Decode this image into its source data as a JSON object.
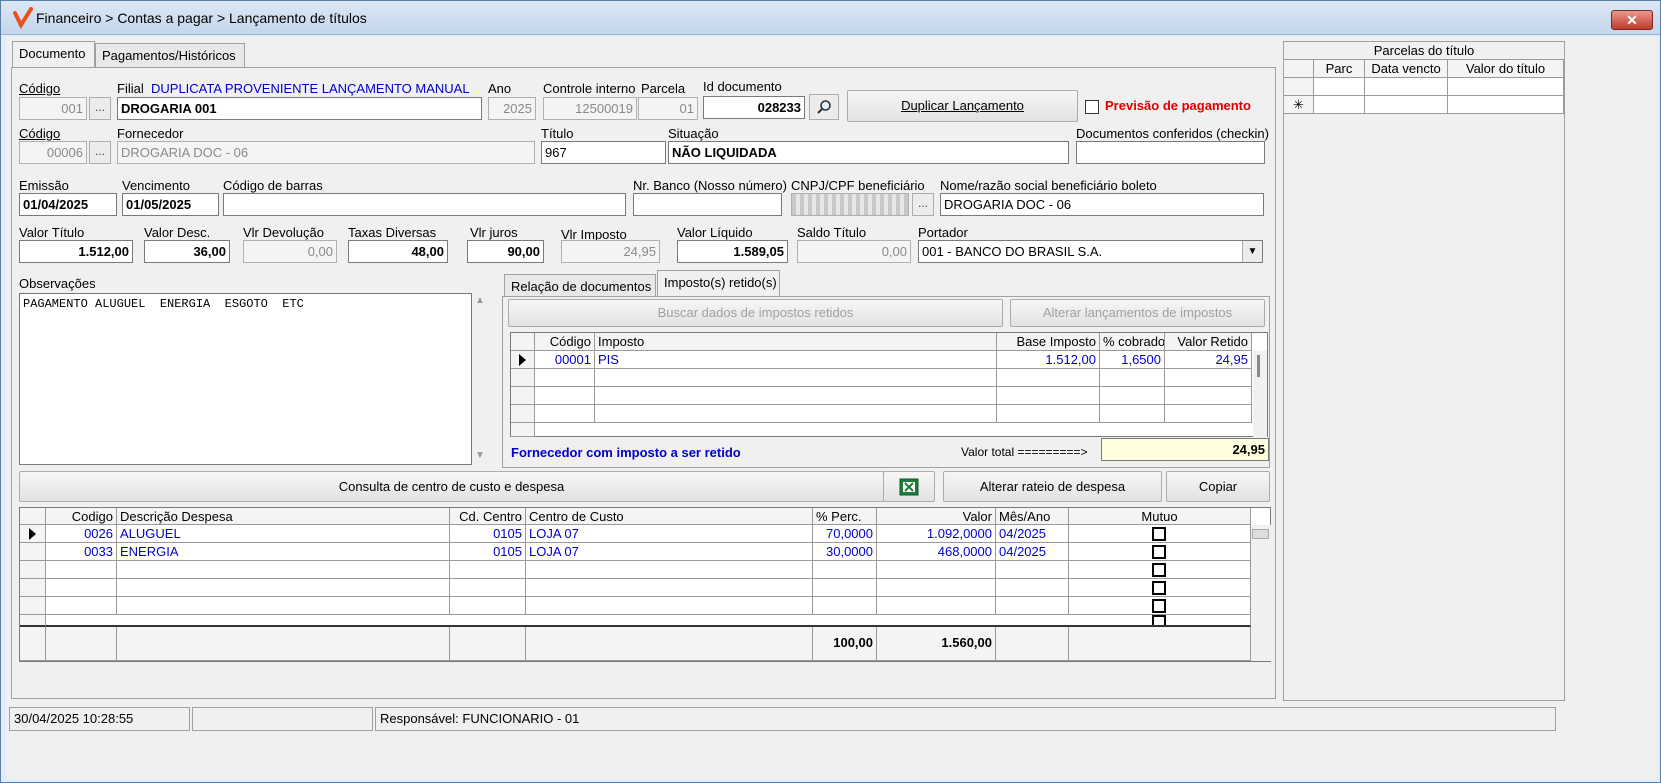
{
  "window": {
    "title": "Financeiro > Contas a pagar > Lançamento de títulos",
    "close_label": "✕"
  },
  "tabs": [
    "Documento",
    "Pagamentos/Históricos"
  ],
  "filial": {
    "codigo_label": "Código",
    "codigo": "001",
    "label": "Filial",
    "subtitle": "DUPLICATA PROVENIENTE LANÇAMENTO MANUAL",
    "nome": "DROGARIA 001",
    "ano_label": "Ano",
    "ano": "2025",
    "controle_label": "Controle interno",
    "controle": "12500019",
    "parcela_label": "Parcela",
    "parcela": "01",
    "id_doc_label": "Id documento",
    "id_doc": "028233"
  },
  "duplicar_label": "Duplicar Lançamento",
  "previsao_label": "Previsão de pagamento",
  "fornecedor": {
    "codigo_label": "Código",
    "codigo": "00006",
    "label": "Fornecedor",
    "nome": "DROGARIA DOC - 06",
    "titulo_label": "Título",
    "titulo": "967",
    "situacao_label": "Situação",
    "situacao": "NÃO LIQUIDADA",
    "checkin_label": "Documentos conferidos (checkin)",
    "checkin": ""
  },
  "datas": {
    "emissao_label": "Emissão",
    "emissao": "01/04/2025",
    "vencimento_label": "Vencimento",
    "vencimento": "01/05/2025",
    "barras_label": "Código de barras",
    "barras": "",
    "nr_banco_label": "Nr. Banco (Nosso número)",
    "nr_banco": "",
    "cnpj_label": "CNPJ/CPF beneficiário",
    "nome_benef_label": "Nome/razão social beneficiário boleto",
    "nome_benef": "DROGARIA DOC - 06"
  },
  "valores": {
    "valor_titulo_label": "Valor Título",
    "valor_titulo": "1.512,00",
    "valor_desc_label": "Valor Desc.",
    "valor_desc": "36,00",
    "vlr_devolucao_label": "Vlr Devolução",
    "vlr_devolucao": "0,00",
    "taxas_label": "Taxas Diversas",
    "taxas": "48,00",
    "juros_label": "Vlr juros",
    "juros": "90,00",
    "imposto_label": "Vlr Imposto",
    "imposto": "24,95",
    "liquido_label": "Valor Líquido",
    "liquido": "1.589,05",
    "saldo_label": "Saldo Título",
    "saldo": "0,00",
    "portador_label": "Portador",
    "portador": "001 - BANCO DO BRASIL S.A."
  },
  "observacoes": {
    "label": "Observações",
    "text": "PAGAMENTO ALUGUEL  ENERGIA  ESGOTO  ETC"
  },
  "subtabs": [
    "Relação de documentos",
    "Imposto(s) retido(s)"
  ],
  "impostos": {
    "buscar_label": "Buscar dados de impostos retidos",
    "alterar_label": "Alterar lançamentos de impostos",
    "headers": [
      "Código",
      "Imposto",
      "Base Imposto",
      "% cobrado",
      "Valor Retido"
    ],
    "rows": [
      [
        "00001",
        "PIS",
        "1.512,00",
        "1,6500",
        "24,95"
      ]
    ],
    "aviso": "Fornecedor com imposto a ser retido",
    "total_label": "Valor total =========>",
    "total": "24,95"
  },
  "rateio": {
    "consulta_label": "Consulta de centro de custo e despesa",
    "alterar_label": "Alterar rateio de despesa",
    "copiar_label": "Copiar",
    "headers": [
      "Codigo",
      "Descrição Despesa",
      "Cd. Centro",
      "Centro de Custo",
      "% Perc.",
      "Valor",
      "Mês/Ano",
      "Mutuo"
    ],
    "rows": [
      [
        "0026",
        "ALUGUEL",
        "0105",
        "LOJA 07",
        "70,0000",
        "1.092,0000",
        "04/2025"
      ],
      [
        "0033",
        "ENERGIA",
        "0105",
        "LOJA 07",
        "30,0000",
        "468,0000",
        "04/2025"
      ]
    ],
    "total_perc": "100,00",
    "total_valor": "1.560,00"
  },
  "parcelas": {
    "title": "Parcelas do título",
    "headers": [
      "Parc",
      "Data vencto",
      "Valor do título"
    ],
    "new_row_marker": "✳"
  },
  "statusbar": {
    "datetime": "30/04/2025 10:28:55",
    "middle": "",
    "responsavel": "Responsável: FUNCIONARIO - 01"
  },
  "colors": {
    "accent_blue": "#0000cc",
    "alert_red": "#e00000",
    "total_bg": "#ffffe0"
  },
  "icons": [
    "logo-icon",
    "close-icon",
    "search-icon",
    "excel-icon",
    "dropdown-arrow-icon",
    "scroll-up-icon",
    "scroll-down-icon"
  ]
}
